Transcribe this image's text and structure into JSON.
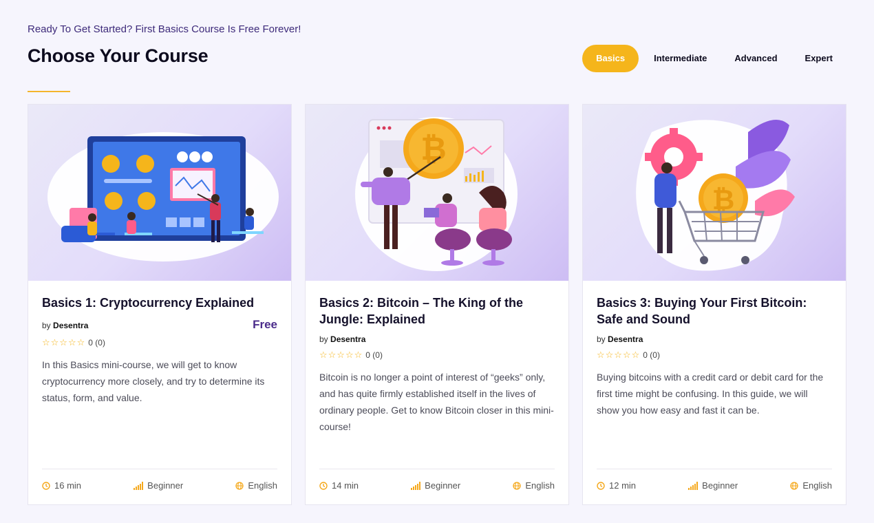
{
  "header": {
    "eyebrow": "Ready To Get Started? First Basics Course Is Free Forever!",
    "title": "Choose Your Course"
  },
  "tabs": [
    {
      "label": "Basics",
      "active": true
    },
    {
      "label": "Intermediate",
      "active": false
    },
    {
      "label": "Advanced",
      "active": false
    },
    {
      "label": "Expert",
      "active": false
    }
  ],
  "courses": [
    {
      "title": "Basics 1: Cryptocurrency Explained",
      "by": "by",
      "author": "Desentra",
      "price": "Free",
      "stars": "☆☆☆☆☆",
      "rating": "0 (0)",
      "description": "In this Basics mini-course, we will get to know cryptocurrency more closely, and try to determine its status, form, and value.",
      "duration": "16 min",
      "level": "Beginner",
      "language": "English"
    },
    {
      "title": "Basics 2: Bitcoin – The King of the Jungle: Explained",
      "by": "by",
      "author": "Desentra",
      "stars": "☆☆☆☆☆",
      "rating": "0 (0)",
      "description": "Bitcoin is no longer a point of interest of “geeks” only, and has quite firmly established itself in the lives of ordinary people. Get to know Bitcoin closer in this mini-course!",
      "duration": "14 min",
      "level": "Beginner",
      "language": "English"
    },
    {
      "title": "Basics 3: Buying Your First Bitcoin: Safe and Sound",
      "by": "by",
      "author": "Desentra",
      "stars": "☆☆☆☆☆",
      "rating": "0 (0)",
      "description": "Buying bitcoins with a credit card or debit card for the first time might be confusing. In this guide, we will show you how easy and fast it can be.",
      "duration": "12 min",
      "level": "Beginner",
      "language": "English"
    }
  ],
  "icons": {
    "clock": "clock-icon",
    "level": "signal-bars-icon",
    "language": "globe-icon"
  },
  "colors": {
    "accent": "#f5b51b",
    "brand": "#4a2b8a",
    "background": "#f6f5fd"
  }
}
